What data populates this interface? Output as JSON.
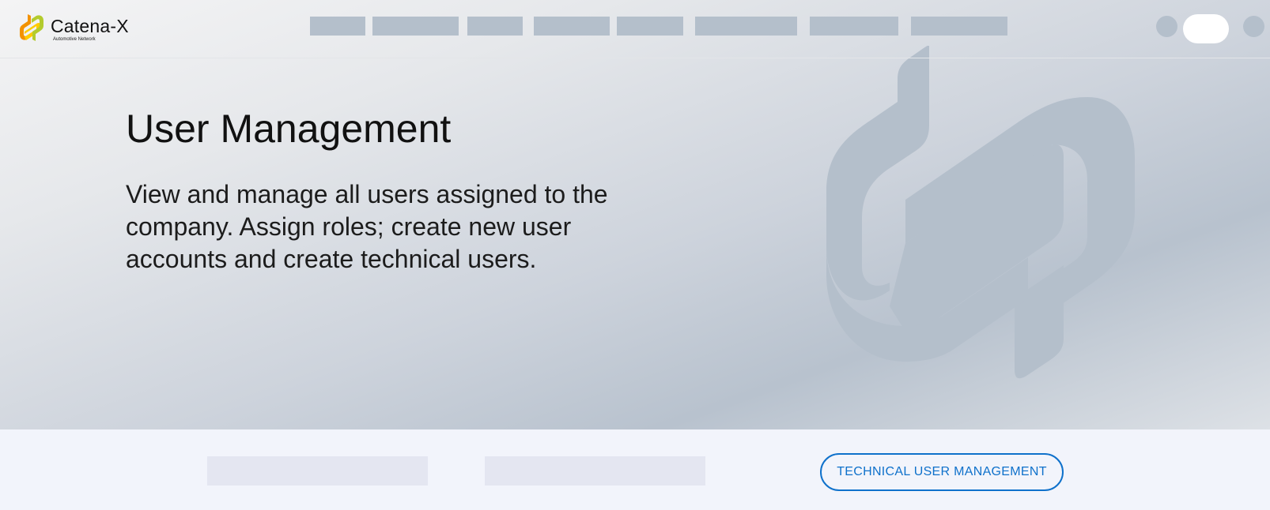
{
  "brand": {
    "name": "Catena-X",
    "tagline": "Automotive Network",
    "colors": {
      "orange": "#F39200",
      "yellow": "#FFCC00",
      "green": "#B3CB2D"
    }
  },
  "header": {
    "nav_items": [
      "",
      "",
      "",
      "",
      "",
      "",
      "",
      ""
    ],
    "icons": [
      "help-icon",
      "user-menu-icon",
      "notification-icon"
    ]
  },
  "hero": {
    "title": "User Management",
    "description": "View and manage all users assigned to the company. Assign roles; create new user accounts and create technical users."
  },
  "actions": {
    "technical_user_label": "TECHNICAL USER MANAGEMENT"
  },
  "colors": {
    "accent": "#0F71CB",
    "placeholder": "#B4BFCB",
    "watermark": "#B4BFCB"
  }
}
